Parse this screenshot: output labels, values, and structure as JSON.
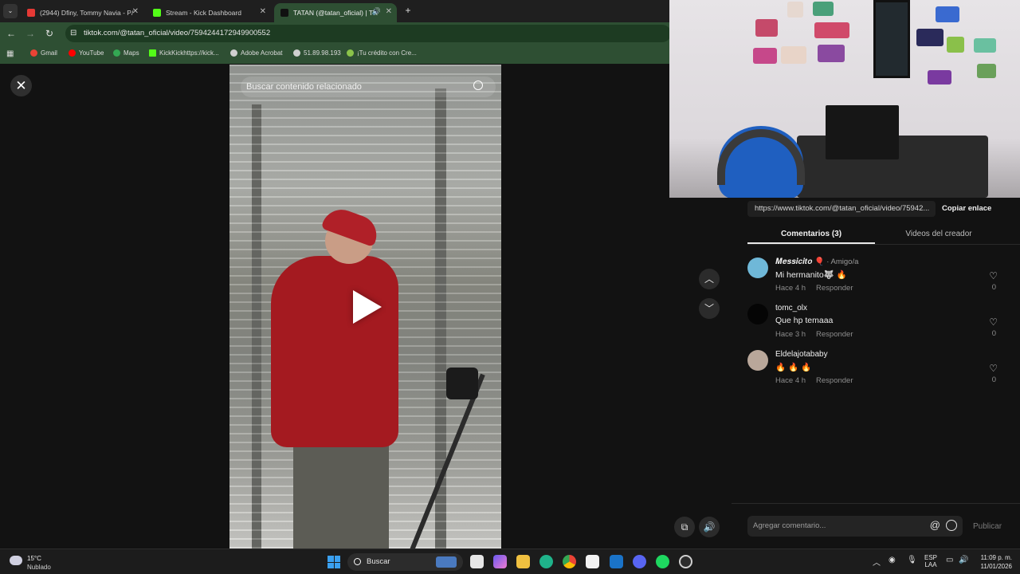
{
  "browser": {
    "tabs": [
      {
        "title": "(2944) Dfiny, Tommy Navia - P/",
        "favicon_color": "#e53935"
      },
      {
        "title": "Stream - Kick Dashboard",
        "favicon_color": "#53fc18"
      },
      {
        "title": "TATAN (@tatan_oficial) | Tik",
        "favicon_color": "#111111"
      }
    ],
    "new_tab": "+",
    "url": "tiktok.com/@tatan_oficial/video/7594244172949900552",
    "bookmarks": [
      {
        "label": "Gmail",
        "color": "#ea4335"
      },
      {
        "label": "YouTube",
        "color": "#ff0000"
      },
      {
        "label": "Maps",
        "color": "#34a853"
      },
      {
        "label": "KickKickhttps://kick...",
        "color": "#53fc18"
      },
      {
        "label": "Adobe Acrobat",
        "color": "#cfcfcf"
      },
      {
        "label": "51.89.98.193",
        "color": "#cfcfcf"
      },
      {
        "label": "¡Tu crédito con Cre...",
        "color": "#8bc34a"
      }
    ]
  },
  "video": {
    "search_placeholder": "Buscar contenido relacionado"
  },
  "panel": {
    "link": "https://www.tiktok.com/@tatan_oficial/video/75942...",
    "copy_label": "Copiar enlace",
    "tabs": [
      "Comentarios (3)",
      "Videos del creador"
    ],
    "comments": [
      {
        "user": "𝑴𝒆𝒔𝒔𝒊𝒄𝒊𝒕𝒐 🎈",
        "extra": " · Amigo/a",
        "text": "Mi hermanito🐺 🔥",
        "time": "Hace 4 h",
        "reply": "Responder",
        "likes": "0",
        "avatar_color": "#6fb8d8"
      },
      {
        "user": "tomc_olx",
        "extra": "",
        "text": "Que hp temaaa",
        "time": "Hace 3 h",
        "reply": "Responder",
        "likes": "0",
        "avatar_color": "#050505"
      },
      {
        "user": "Eldelajotababy",
        "extra": "",
        "text": "🔥 🔥 🔥",
        "time": "Hace 4 h",
        "reply": "Responder",
        "likes": "0",
        "avatar_color": "#b9a79a"
      }
    ],
    "comment_placeholder": "Agregar comentario...",
    "at_symbol": "@",
    "publish_label": "Publicar"
  },
  "taskbar": {
    "temperature": "15°C",
    "condition": "Nublado",
    "search_label": "Buscar",
    "lang_top": "ESP",
    "lang_bottom": "LAA",
    "time": "11:09 p. m.",
    "date": "11/01/2026"
  }
}
